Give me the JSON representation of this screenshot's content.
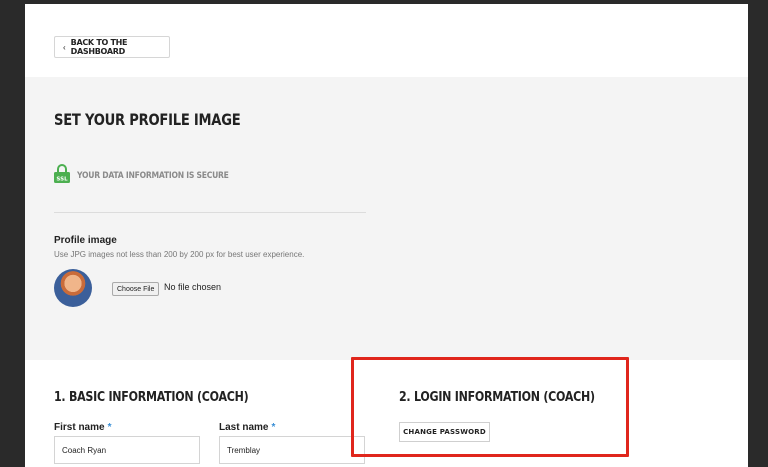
{
  "nav": {
    "back_label": "BACK TO THE DASHBOARD"
  },
  "profile": {
    "title": "SET YOUR PROFILE IMAGE",
    "ssl_badge": "SSL",
    "secure_text": "YOUR DATA INFORMATION IS SECURE",
    "image_label": "Profile image",
    "image_hint": "Use JPG images not less than 200 by 200 px for best user experience.",
    "choose_file_label": "Choose File",
    "no_file_text": "No file chosen"
  },
  "basic": {
    "title": "1. BASIC INFORMATION (COACH)",
    "first_name_label": "First name",
    "last_name_label": "Last name",
    "required_mark": "*",
    "first_name_value": "Coach Ryan",
    "last_name_value": "Tremblay"
  },
  "login": {
    "title": "2. LOGIN INFORMATION (COACH)",
    "change_password_label": "CHANGE PASSWORD"
  },
  "colors": {
    "highlight": "#e0261c",
    "ssl_green": "#4caf50",
    "required": "#3a8fd6"
  }
}
